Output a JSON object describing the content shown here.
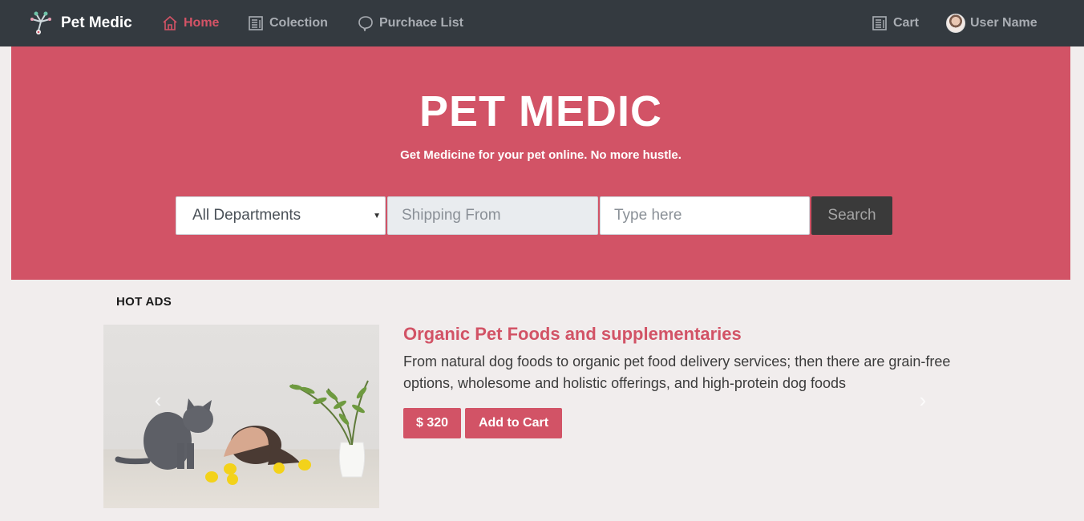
{
  "navbar": {
    "brand": "Pet Medic",
    "items": [
      {
        "label": "Home",
        "icon": "home-icon",
        "active": true
      },
      {
        "label": "Colection",
        "icon": "document-icon"
      },
      {
        "label": "Purchace List",
        "icon": "chat-bubble-icon"
      }
    ],
    "cart_label": "Cart",
    "user_name": "User Name"
  },
  "hero": {
    "title": "PET MEDIC",
    "subtitle": "Get Medicine for your pet online. No more hustle.",
    "department_select": "All Departments",
    "shipping_placeholder": "Shipping From",
    "search_placeholder": "Type here",
    "search_button": "Search"
  },
  "hot_ads": {
    "label": "HOT ADS",
    "ad": {
      "title": "Organic Pet Foods and supplementaries",
      "description": "From natural dog foods to organic pet food delivery services; then there are grain-free options, wholesome and holistic offerings, and high-protein dog foods",
      "price": "$ 320",
      "add_to_cart": "Add to Cart"
    }
  },
  "colors": {
    "navbar_bg": "#343a40",
    "accent": "#d25366",
    "page_bg": "#f1eded",
    "search_button_bg": "#3a3a3a"
  }
}
